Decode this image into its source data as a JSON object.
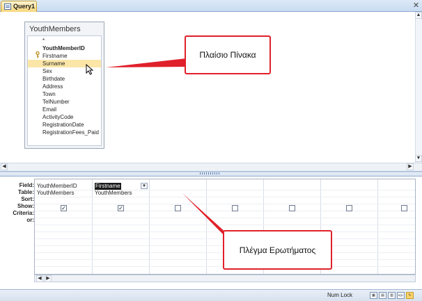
{
  "tab": {
    "label": "Query1"
  },
  "table_box": {
    "title": "YouthMembers",
    "fields": [
      "*",
      "YouthMemberID",
      "Firstname",
      "Surname",
      "Sex",
      "Birthdate",
      "Address",
      "Town",
      "TelNumber",
      "Email",
      "ActivityCode",
      "RegistrationDate",
      "RegistrationFees_Paid"
    ],
    "selected_field": "Surname",
    "primary_key_field": "YouthMemberID"
  },
  "callouts": {
    "table": "Πλαίσιο Πίνακα",
    "grid": "Πλέγμα Ερωτήματος"
  },
  "design_grid": {
    "row_labels": [
      "Field:",
      "Table:",
      "Sort:",
      "Show:",
      "Criteria:",
      "or:"
    ],
    "columns": [
      {
        "field": "YouthMemberID",
        "table": "YouthMembers",
        "show": true
      },
      {
        "field": "Firstname",
        "table": "YouthMembers",
        "show": true,
        "selected": true
      },
      {
        "field": "",
        "table": "",
        "show": false
      },
      {
        "field": "",
        "table": "",
        "show": false
      },
      {
        "field": "",
        "table": "",
        "show": false
      },
      {
        "field": "",
        "table": "",
        "show": false
      },
      {
        "field": "",
        "table": "",
        "show": false
      }
    ]
  },
  "status_bar": {
    "num_lock": "Num Lock",
    "view_sql": "SQL"
  },
  "colors": {
    "callout_border": "#e0202a",
    "selection": "#fbe6a8",
    "tab_active": "#f7d77a"
  },
  "icons": [
    "query-icon",
    "close-icon",
    "key-icon",
    "cursor-icon",
    "dropdown-arrow-icon",
    "checkbox-icon",
    "view-icon"
  ]
}
